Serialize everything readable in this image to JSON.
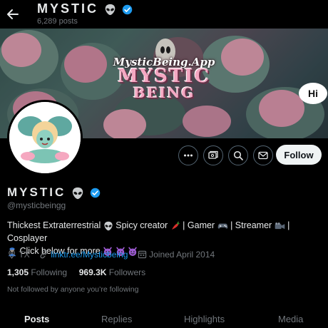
{
  "header": {
    "name": "MYSTIC",
    "post_count": "6,289 posts"
  },
  "banner": {
    "app_text": "MysticBeing.App",
    "logo_line1": "MYSTIC",
    "logo_line2": "BEING",
    "bubble_text": "Hi"
  },
  "profile": {
    "display_name": "MYSTIC",
    "handle": "@mysticbeingg",
    "bio_line1_a": "Thickest Extraterrestrial",
    "bio_line1_b": "Spicy creator",
    "bio_line1_c": "| Gamer",
    "bio_line1_d": "| Streamer",
    "bio_line1_e": "| Cosplayer",
    "bio_line2": "Click below for more",
    "location": "TX",
    "link": "linktr.ee/Mysticbeing",
    "joined": "Joined April 2014",
    "following_count": "1,305",
    "following_label": "Following",
    "followers_count": "969.3K",
    "followers_label": "Followers",
    "not_followed": "Not followed by anyone you’re following"
  },
  "actions": {
    "follow_label": "Follow"
  },
  "tabs": [
    "Posts",
    "Replies",
    "Highlights",
    "Media"
  ],
  "colors": {
    "accent": "#1d9bf0",
    "background": "#000000",
    "muted": "#71767b"
  }
}
